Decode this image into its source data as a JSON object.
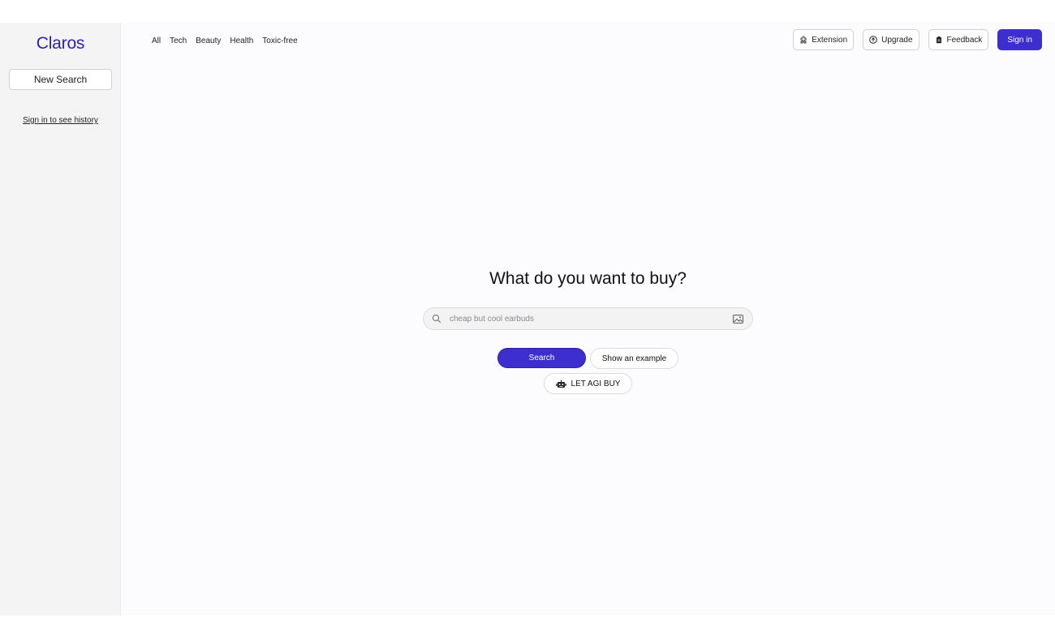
{
  "brand": {
    "name": "Claros",
    "color": "#2a1fb8"
  },
  "sidebar": {
    "new_search_label": "New Search",
    "history_link": "Sign in to see history"
  },
  "categories": [
    "All",
    "Tech",
    "Beauty",
    "Health",
    "Toxic-free"
  ],
  "top_actions": {
    "extension": "Extension",
    "upgrade": "Upgrade",
    "feedback": "Feedback",
    "sign_in": "Sign in"
  },
  "main": {
    "headline": "What do you want to buy?",
    "search_placeholder": "cheap but cool earbuds",
    "search_button": "Search",
    "example_button": "Show an example",
    "agi_button": "LET AGI BUY"
  },
  "colors": {
    "accent": "#3d2fcf",
    "sidebar_bg": "#f4f4f5",
    "page_bg": "#fcfcfe"
  },
  "icons": [
    "puzzle-icon",
    "arrow-up-circle-icon",
    "clipboard-icon",
    "search-icon",
    "image-icon",
    "robot-icon"
  ]
}
